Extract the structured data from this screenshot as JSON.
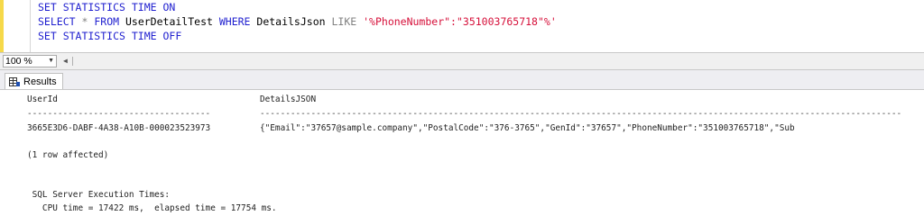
{
  "editor": {
    "lines": [
      {
        "parts": [
          {
            "cls": "kw",
            "text": "SET STATISTICS TIME ON"
          }
        ]
      },
      {
        "parts": [
          {
            "cls": "kw",
            "text": "SELECT"
          },
          {
            "cls": "id",
            "text": " "
          },
          {
            "cls": "op",
            "text": "*"
          },
          {
            "cls": "id",
            "text": " "
          },
          {
            "cls": "kw",
            "text": "FROM"
          },
          {
            "cls": "id",
            "text": " UserDetailTest "
          },
          {
            "cls": "kw",
            "text": "WHERE"
          },
          {
            "cls": "id",
            "text": " DetailsJson "
          },
          {
            "cls": "op",
            "text": "LIKE"
          },
          {
            "cls": "id",
            "text": " "
          },
          {
            "cls": "str",
            "text": "'%PhoneNumber\":\"351003765718\"%'"
          }
        ]
      },
      {
        "parts": [
          {
            "cls": "kw",
            "text": "SET STATISTICS TIME OFF"
          }
        ]
      }
    ]
  },
  "zoom": {
    "value": "100 %"
  },
  "results_tab": {
    "label": "Results"
  },
  "results": {
    "headers": {
      "userid": "UserId",
      "details": "DetailsJSON"
    },
    "dash_userid": "------------------------------------",
    "dash_details": "------------------------------------------------------------------------------------------------------------------------------",
    "row": {
      "userid": "3665E3D6-DABF-4A38-A10B-000023523973",
      "details": "{\"Email\":\"37657@sample.company\",\"PostalCode\":\"376-3765\",\"GenId\":\"37657\",\"PhoneNumber\":\"351003765718\",\"Sub"
    },
    "rows_affected": "(1 row affected)",
    "exec_title": " SQL Server Execution Times:",
    "exec_times": "   CPU time = 17422 ms,  elapsed time = 17754 ms."
  },
  "colors": {
    "keyword": "#1f1fcf",
    "string": "#d6103a",
    "operator": "#808080",
    "gutter_marker": "#f6d94a"
  }
}
